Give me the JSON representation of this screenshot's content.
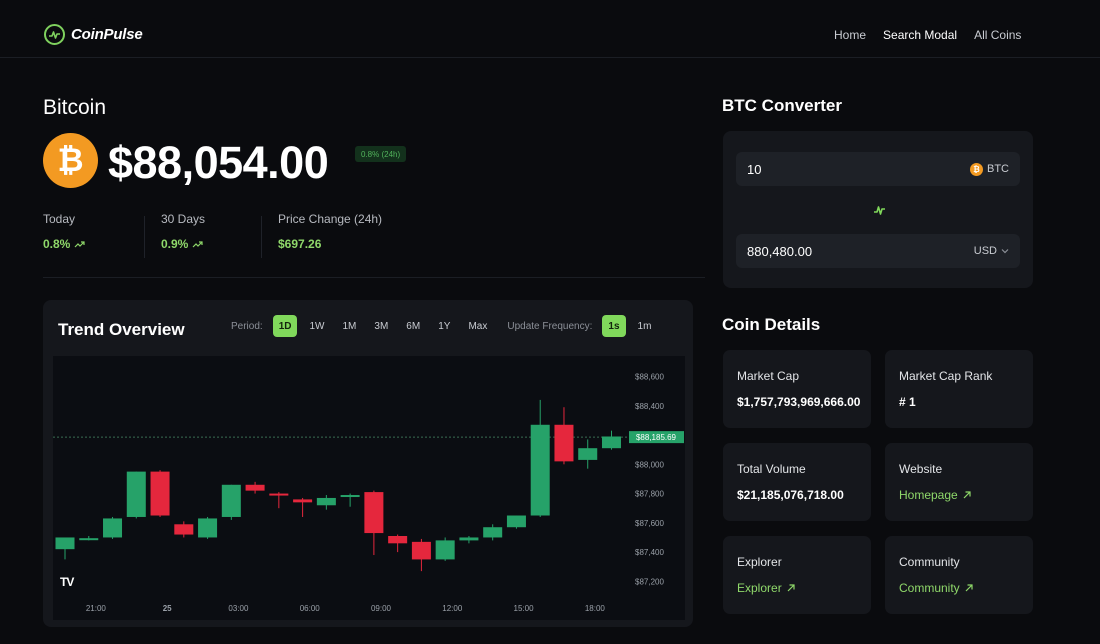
{
  "header": {
    "brand": "CoinPulse",
    "nav": [
      {
        "label": "Home"
      },
      {
        "label": "Search Modal"
      },
      {
        "label": "All Coins"
      }
    ]
  },
  "coin": {
    "name": "Bitcoin",
    "icon_symbol": "₿",
    "price": "$88,054.00",
    "change_badge": "0.8% (24h)",
    "stats": [
      {
        "label": "Today",
        "value": "0.8%",
        "trend_icon": "trending-up-icon"
      },
      {
        "label": "30 Days",
        "value": "0.9%",
        "trend_icon": "trending-up-icon"
      },
      {
        "label": "Price Change (24h)",
        "value": "$697.26"
      }
    ]
  },
  "trend": {
    "title": "Trend Overview",
    "period_label": "Period:",
    "periods": [
      "1D",
      "1W",
      "1M",
      "3M",
      "6M",
      "1Y",
      "Max"
    ],
    "active_period": "1D",
    "frequency_label": "Update Frequency:",
    "frequencies": [
      "1s",
      "1m"
    ],
    "active_frequency": "1s",
    "tv_mark": "TV"
  },
  "chart_data": {
    "type": "candlestick",
    "x_ticks": [
      "21:00",
      "25",
      "03:00",
      "06:00",
      "09:00",
      "12:00",
      "15:00",
      "18:00"
    ],
    "y_ticks": [
      "$88,600",
      "$88,400",
      "$88,200",
      "$88,000",
      "$87,800",
      "$87,600",
      "$87,400",
      "$87,200"
    ],
    "ylim": [
      87100,
      88740
    ],
    "current_price_label": "$88,185.69",
    "current_price": 88185.69,
    "up_color": "#26a269",
    "down_color": "#e5273d",
    "candles": [
      {
        "o": 87420,
        "h": 87490,
        "l": 87350,
        "c": 87500
      },
      {
        "o": 87490,
        "h": 87510,
        "l": 87480,
        "c": 87495
      },
      {
        "o": 87500,
        "h": 87640,
        "l": 87490,
        "c": 87630
      },
      {
        "o": 87640,
        "h": 87950,
        "l": 87630,
        "c": 87950
      },
      {
        "o": 87950,
        "h": 87960,
        "l": 87640,
        "c": 87650
      },
      {
        "o": 87590,
        "h": 87610,
        "l": 87500,
        "c": 87520
      },
      {
        "o": 87500,
        "h": 87640,
        "l": 87490,
        "c": 87630
      },
      {
        "o": 87640,
        "h": 87860,
        "l": 87620,
        "c": 87860
      },
      {
        "o": 87860,
        "h": 87880,
        "l": 87800,
        "c": 87820
      },
      {
        "o": 87800,
        "h": 87810,
        "l": 87700,
        "c": 87790
      },
      {
        "o": 87760,
        "h": 87770,
        "l": 87640,
        "c": 87740
      },
      {
        "o": 87720,
        "h": 87790,
        "l": 87690,
        "c": 87770
      },
      {
        "o": 87790,
        "h": 87800,
        "l": 87710,
        "c": 87790
      },
      {
        "o": 87810,
        "h": 87820,
        "l": 87380,
        "c": 87530
      },
      {
        "o": 87510,
        "h": 87520,
        "l": 87400,
        "c": 87460
      },
      {
        "o": 87470,
        "h": 87490,
        "l": 87270,
        "c": 87350
      },
      {
        "o": 87350,
        "h": 87500,
        "l": 87340,
        "c": 87480
      },
      {
        "o": 87480,
        "h": 87510,
        "l": 87460,
        "c": 87500
      },
      {
        "o": 87500,
        "h": 87590,
        "l": 87480,
        "c": 87570
      },
      {
        "o": 87570,
        "h": 87650,
        "l": 87560,
        "c": 87650
      },
      {
        "o": 87650,
        "h": 88440,
        "l": 87640,
        "c": 88270
      },
      {
        "o": 88270,
        "h": 88390,
        "l": 88000,
        "c": 88020
      },
      {
        "o": 88030,
        "h": 88170,
        "l": 87970,
        "c": 88110
      },
      {
        "o": 88110,
        "h": 88230,
        "l": 88100,
        "c": 88190
      }
    ]
  },
  "converter": {
    "title": "BTC Converter",
    "amount": "10",
    "from_symbol": "₿",
    "from_unit": "BTC",
    "result": "880,480.00",
    "to_unit": "USD"
  },
  "details": {
    "title": "Coin Details",
    "cards": [
      {
        "label": "Market Cap",
        "value": "$1,757,793,969,666.00"
      },
      {
        "label": "Market Cap Rank",
        "value": "# 1"
      },
      {
        "label": "Total Volume",
        "value": "$21,185,076,718.00"
      },
      {
        "label": "Website",
        "link": "Homepage"
      },
      {
        "label": "Explorer",
        "link": "Explorer"
      },
      {
        "label": "Community",
        "link": "Community"
      }
    ]
  },
  "colors": {
    "accent": "#80d85b",
    "positive": "#8fd86a",
    "bitcoin": "#f39a22"
  }
}
